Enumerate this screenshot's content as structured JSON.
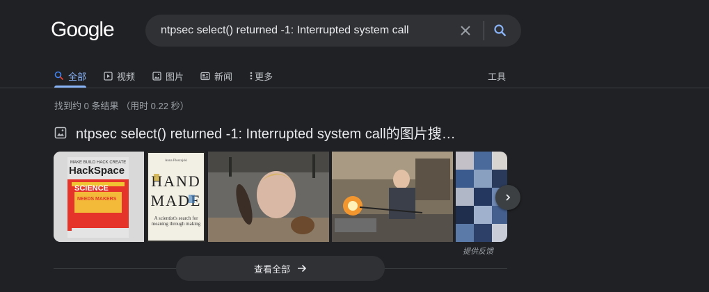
{
  "header": {
    "logo": "Google",
    "search": {
      "value": "ntpsec select() returned -1: Interrupted system call",
      "placeholder": ""
    }
  },
  "tabs": [
    {
      "label": "全部",
      "icon": "search-icon",
      "active": true
    },
    {
      "label": "视频",
      "icon": "video-icon",
      "active": false
    },
    {
      "label": "图片",
      "icon": "image-icon",
      "active": false
    },
    {
      "label": "新闻",
      "icon": "news-icon",
      "active": false
    },
    {
      "label": "更多",
      "icon": "more-vert-icon",
      "active": false
    }
  ],
  "tools_label": "工具",
  "results": {
    "stats": "找到约 0 条结果  （用时 0.22 秒）",
    "images_heading": "ntpsec select() returned -1: Interrupted system call的图片搜…",
    "thumbnails": [
      {
        "name": "hackspace-magazine-cover",
        "text": [
          "MAKE BUILD HACK CREATE",
          "HackSpace",
          "SCIENCE",
          "NEEDS MAKERS"
        ]
      },
      {
        "name": "hand-made-book-cover",
        "text": [
          "Anna Ploszajski",
          "HAND",
          "MADE",
          "A scientist's search for meaning through making"
        ]
      },
      {
        "name": "person-with-pinecone-photo",
        "text": []
      },
      {
        "name": "glassblowing-workshop-photo",
        "text": []
      },
      {
        "name": "knitted-patchwork-photo",
        "text": []
      }
    ],
    "feedback": "提供反馈",
    "view_all": "查看全部"
  },
  "colors": {
    "background": "#202124",
    "accent": "#8ab4f8",
    "searchbox": "#303134",
    "text": "#e8eaed",
    "muted": "#9aa0a6"
  }
}
